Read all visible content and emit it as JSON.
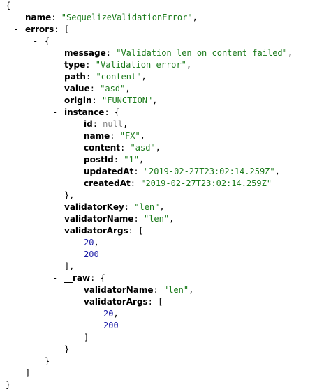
{
  "lines": [
    {
      "t": "{"
    },
    {
      "k": "name",
      "v": "\"SequelizeValidationError\"",
      "vt": "str",
      "tail": ","
    },
    {
      "k": "errors",
      "tail": " ["
    },
    {
      "t": "{"
    },
    {
      "k": "message",
      "v": "\"Validation len on content failed\"",
      "vt": "str",
      "tail": ","
    },
    {
      "k": "type",
      "v": "\"Validation error\"",
      "vt": "str",
      "tail": ","
    },
    {
      "k": "path",
      "v": "\"content\"",
      "vt": "str",
      "tail": ","
    },
    {
      "k": "value",
      "v": "\"asd\"",
      "vt": "str",
      "tail": ","
    },
    {
      "k": "origin",
      "v": "\"FUNCTION\"",
      "vt": "str",
      "tail": ","
    },
    {
      "k": "instance",
      "tail": " {"
    },
    {
      "k": "id",
      "v": "null",
      "vt": "null",
      "tail": ","
    },
    {
      "k": "name",
      "v": "\"FX\"",
      "vt": "str",
      "tail": ","
    },
    {
      "k": "content",
      "v": "\"asd\"",
      "vt": "str",
      "tail": ","
    },
    {
      "k": "postId",
      "v": "\"1\"",
      "vt": "str",
      "tail": ","
    },
    {
      "k": "updatedAt",
      "v": "\"2019-02-27T23:02:14.259Z\"",
      "vt": "str",
      "tail": ","
    },
    {
      "k": "createdAt",
      "v": "\"2019-02-27T23:02:14.259Z\"",
      "vt": "str",
      "tail": ""
    },
    {
      "t": "},"
    },
    {
      "k": "validatorKey",
      "v": "\"len\"",
      "vt": "str",
      "tail": ","
    },
    {
      "k": "validatorName",
      "v": "\"len\"",
      "vt": "str",
      "tail": ","
    },
    {
      "k": "validatorArgs",
      "tail": " ["
    },
    {
      "v": "20",
      "vt": "num",
      "tail": ","
    },
    {
      "v": "200",
      "vt": "num",
      "tail": ""
    },
    {
      "t": "],"
    },
    {
      "k": "__raw",
      "tail": " {"
    },
    {
      "k": "validatorName",
      "v": "\"len\"",
      "vt": "str",
      "tail": ","
    },
    {
      "k": "validatorArgs",
      "tail": " ["
    },
    {
      "v": "20",
      "vt": "num",
      "tail": ","
    },
    {
      "v": "200",
      "vt": "num",
      "tail": ""
    },
    {
      "t": "]"
    },
    {
      "t": "}"
    },
    {
      "t": "}"
    },
    {
      "t": "]"
    },
    {
      "t": "}"
    }
  ],
  "toggle_glyph": "-",
  "colors": {
    "string": "#1a7a1a",
    "number": "#1a1aa6",
    "null": "#808080",
    "key": "#000000"
  }
}
